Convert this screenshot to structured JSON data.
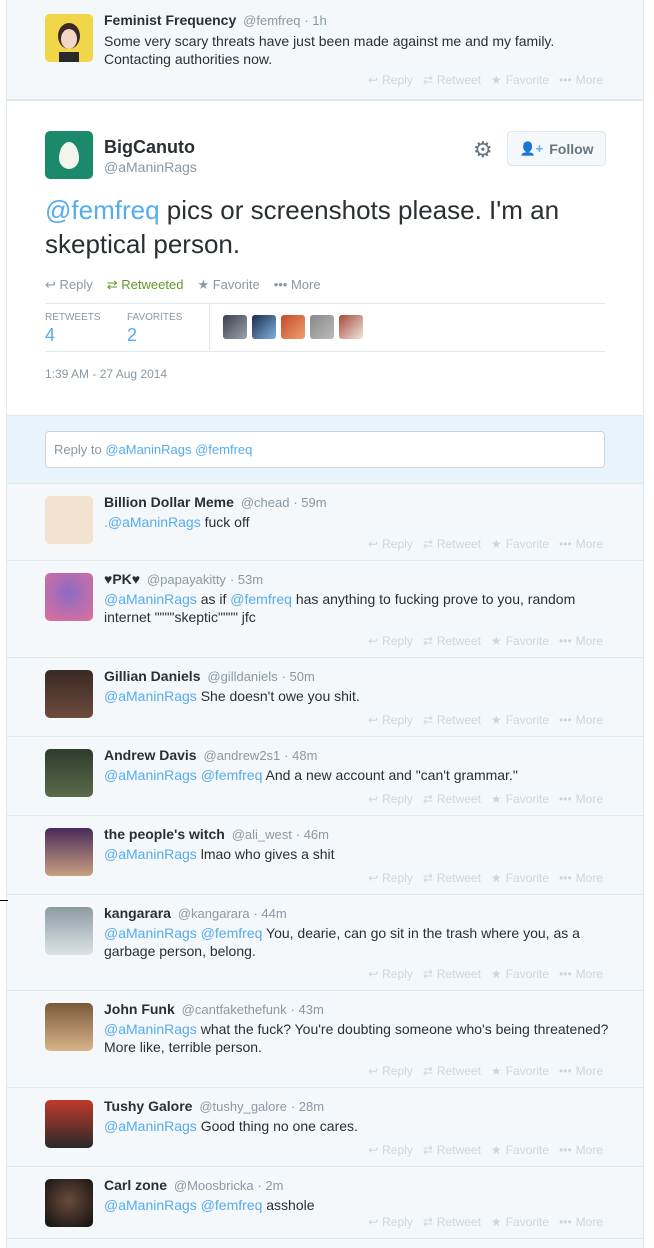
{
  "top_tweet": {
    "name": "Feminist Frequency",
    "handle": "@femfreq",
    "time": "· 1h",
    "text": "Some very scary threats have just been made against me and my family. Contacting authorities now."
  },
  "actions": {
    "reply": "Reply",
    "retweet": "Retweet",
    "favorite": "Favorite",
    "more": "More",
    "retweeted": "Retweeted"
  },
  "main_tweet": {
    "name": "BigCanuto",
    "handle": "@aManinRags",
    "follow_label": "Follow",
    "mention": "@femfreq",
    "text": " pics or screenshots please. I'm an skeptical person.",
    "retweets_label": "RETWEETS",
    "retweets": "4",
    "favorites_label": "FAVORITES",
    "favorites": "2",
    "timestamp": "1:39 AM - 27 Aug 2014"
  },
  "reply_box": {
    "prefix": "Reply to ",
    "mentions": "@aManinRags @femfreq"
  },
  "replies": [
    {
      "name": "Billion Dollar Meme",
      "handle": "@chead",
      "time": "· 59m",
      "mention": ".@aManinRags",
      "text": " fuck off"
    },
    {
      "name": "♥PK♥",
      "handle": "@papayakitty",
      "time": "· 53m",
      "mention": "@aManinRags",
      "text": " as if ",
      "mention2": "@femfreq",
      "text2": " has anything to fucking prove to you, random internet \"\"\"\"skeptic\"\"\"\" jfc"
    },
    {
      "name": "Gillian Daniels",
      "handle": "@gilldaniels",
      "time": "· 50m",
      "mention": "@aManinRags",
      "text": " She doesn't owe you shit."
    },
    {
      "name": "Andrew Davis",
      "handle": "@andrew2s1",
      "time": "· 48m",
      "mention": "@aManinRags @femfreq",
      "text": " And a new account and \"can't grammar.\""
    },
    {
      "name": "the people's witch",
      "handle": "@ali_west",
      "time": "· 46m",
      "mention": "@aManinRags",
      "text": " lmao who gives a shit"
    },
    {
      "name": "kangarara",
      "handle": "@kangarara",
      "time": "· 44m",
      "mention": "@aManinRags @femfreq",
      "text": " You, dearie, can go sit in the trash where you, as a garbage person, belong."
    },
    {
      "name": "John Funk",
      "handle": "@cantfakethefunk",
      "time": "· 43m",
      "mention": "@aManinRags",
      "text": " what the fuck? You're doubting someone who's being threatened? More like, terrible person."
    },
    {
      "name": "Tushy Galore",
      "handle": "@tushy_galore",
      "time": "· 28m",
      "mention": "@aManinRags",
      "text": " Good thing no one cares."
    },
    {
      "name": "Carl zone",
      "handle": "@Moosbricka",
      "time": "· 2m",
      "mention": "@aManinRags @femfreq",
      "text": " asshole"
    }
  ]
}
